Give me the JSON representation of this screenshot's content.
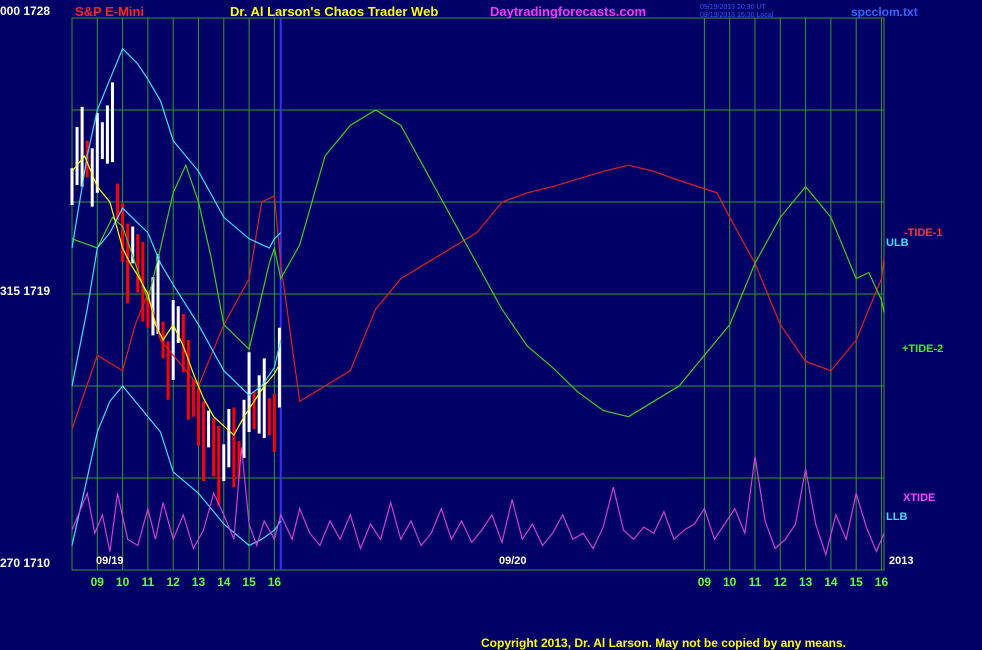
{
  "header": {
    "instrument": "S&P E-Mini",
    "title": "Dr. Al Larson's Chaos Trader Web",
    "website": "Daytradingforecasts.com",
    "timestamp_line1": "09/19/2013 20:30 UT",
    "timestamp_line2": "09/19/2013 15:30 Local",
    "file": "spcclom.txt"
  },
  "axis_labels": {
    "top": "000  1728",
    "mid": "315  1719",
    "bottom": "270  1710",
    "date_left": "09/19",
    "date_mid": "09/20",
    "year": "2013"
  },
  "series_labels": {
    "tide1": "-TIDE-1",
    "ulb": "ULB",
    "tide2": "+TIDE-2",
    "xtide": "XTIDE",
    "llb": "LLB"
  },
  "copyright": "Copyright 2013, Dr. Al Larson. May not be copied by any means.",
  "colors": {
    "background": "#000066",
    "grid": "#339933",
    "divider": "#3333ff",
    "bars_up": "#ffffff",
    "bars_down": "#ff0000",
    "tide1": "#dd2222",
    "tide2": "#44cc22",
    "bands": "#44ddff",
    "xtide": "#cc44cc",
    "ema": "#ffff00",
    "tick_labels": "#66ff33"
  },
  "chart_data": {
    "type": "line",
    "title": "Dr. Al Larson's Chaos Trader Web",
    "x_tick_labels": [
      "09",
      "10",
      "11",
      "12",
      "13",
      "14",
      "15",
      "16",
      "09",
      "10",
      "11",
      "12",
      "13",
      "14",
      "15",
      "16"
    ],
    "x_tick_hours": [
      9,
      10,
      11,
      12,
      13,
      14,
      15,
      16,
      33,
      34,
      35,
      36,
      37,
      38,
      39,
      40
    ],
    "xlim": [
      8,
      40.1
    ],
    "ylim": [
      1710,
      1728
    ],
    "y_tick_labels": [
      "000  1728",
      "315  1719",
      "270  1710"
    ],
    "grid": true,
    "divider_hour": 16.25,
    "series": [
      {
        "name": "-TIDE-1",
        "color": "#dd2222",
        "x": [
          8,
          9,
          10,
          10.5,
          11,
          11.5,
          12,
          13,
          14,
          15,
          15.5,
          16,
          16.25,
          17,
          19,
          20,
          21,
          22,
          23,
          24,
          25,
          26,
          27,
          29,
          30,
          31,
          32,
          33.5,
          34,
          35,
          36,
          37,
          38,
          39,
          39.5,
          40,
          40.1
        ],
        "y": [
          1714.6,
          1717,
          1716.5,
          1718,
          1719,
          1717.5,
          1717,
          1716,
          1718,
          1719.5,
          1722,
          1722.2,
          1720,
          1715.5,
          1716.5,
          1718.5,
          1719.5,
          1720,
          1720.5,
          1721,
          1722,
          1722.3,
          1722.5,
          1723,
          1723.2,
          1723,
          1722.7,
          1722.3,
          1721.5,
          1720,
          1718,
          1716.8,
          1716.5,
          1717.5,
          1718.5,
          1719.5,
          1720.2
        ]
      },
      {
        "name": "+TIDE-2",
        "color": "#44cc22",
        "x": [
          8,
          9,
          9.6,
          10,
          11,
          11.5,
          12,
          12.5,
          13,
          13.5,
          14,
          15,
          15.8,
          16,
          16.25,
          17,
          18,
          19,
          20,
          21,
          22,
          23,
          24,
          25,
          26,
          27,
          28,
          29,
          30,
          31,
          32,
          33,
          34,
          35,
          36,
          37,
          38,
          38.5,
          39,
          39.5,
          40,
          40.1
        ],
        "y": [
          1720.8,
          1720.5,
          1721.5,
          1721.2,
          1718.8,
          1720.5,
          1722.3,
          1723.2,
          1722,
          1720.2,
          1718,
          1717.2,
          1720,
          1720.5,
          1719.5,
          1720.6,
          1723.5,
          1724.5,
          1725,
          1724.5,
          1723,
          1721.5,
          1720,
          1718.5,
          1717.3,
          1716.6,
          1715.8,
          1715.2,
          1715,
          1715.5,
          1716,
          1717,
          1718,
          1720,
          1721.5,
          1722.5,
          1721.5,
          1720.5,
          1719.5,
          1719.7,
          1718.8,
          1718.4
        ]
      },
      {
        "name": "ULB",
        "color": "#44ddff",
        "x": [
          8,
          8.6,
          9,
          9.5,
          10,
          10.6,
          11,
          11.5,
          12,
          13,
          14,
          15,
          15.8,
          16,
          16.25
        ],
        "y": [
          1720.5,
          1723.5,
          1725,
          1726,
          1727,
          1726.5,
          1726,
          1725.3,
          1724,
          1723,
          1721.5,
          1720.8,
          1720.5,
          1720.8,
          1721
        ]
      },
      {
        "name": "Mid band",
        "color": "#44ddff",
        "x": [
          8,
          8.6,
          9,
          9.5,
          10,
          10.5,
          11,
          11.5,
          12,
          13,
          14,
          15,
          15.5,
          16,
          16.25
        ],
        "y": [
          1716,
          1718.5,
          1720.5,
          1721,
          1721.8,
          1721.4,
          1721,
          1720,
          1719.3,
          1718,
          1716.5,
          1715.7,
          1716,
          1716.6,
          1717.5
        ]
      },
      {
        "name": "LLB",
        "color": "#44ddff",
        "x": [
          8,
          8.6,
          9,
          9.5,
          10,
          10.5,
          11,
          11.5,
          12,
          13,
          14,
          15,
          15.5,
          16,
          16.25
        ],
        "y": [
          1710.8,
          1713,
          1714.5,
          1715.5,
          1716,
          1715.5,
          1715,
          1714.5,
          1713.2,
          1712.5,
          1711.5,
          1710.8,
          1711,
          1711.3,
          1711.6
        ]
      },
      {
        "name": "XTIDE",
        "color": "#cc44cc",
        "x": [
          8,
          8.6,
          8.9,
          9.2,
          9.5,
          9.8,
          10.2,
          10.6,
          11,
          11.3,
          11.6,
          12,
          12.4,
          12.8,
          13.2,
          13.6,
          14,
          14.4,
          14.7,
          15,
          15.3,
          15.6,
          16,
          16.25,
          16.7,
          17,
          17.4,
          17.8,
          18.2,
          18.6,
          19,
          19.4,
          19.8,
          20.2,
          20.6,
          21,
          21.4,
          21.8,
          22.2,
          22.6,
          23,
          23.4,
          23.8,
          24.2,
          24.6,
          25,
          25.4,
          25.8,
          26.2,
          26.6,
          27,
          27.4,
          27.8,
          28.2,
          28.6,
          29,
          29.4,
          29.8,
          30.2,
          30.6,
          31,
          31.4,
          31.8,
          32.2,
          32.6,
          33,
          33.4,
          33.8,
          34.2,
          34.6,
          35,
          35.4,
          35.8,
          36.2,
          36.6,
          37,
          37.4,
          37.8,
          38.2,
          38.6,
          39,
          39.4,
          39.8,
          40.1
        ],
        "y": [
          1711.3,
          1712.5,
          1711.2,
          1711.8,
          1710.6,
          1712.5,
          1711,
          1710.8,
          1712,
          1711,
          1712.2,
          1711,
          1711.8,
          1710.7,
          1711.3,
          1712.5,
          1711.8,
          1711,
          1714,
          1711.5,
          1710.8,
          1711.6,
          1711,
          1711.8,
          1711,
          1712,
          1711.2,
          1710.8,
          1711.6,
          1711,
          1711.8,
          1710.7,
          1711.5,
          1711,
          1712.2,
          1711,
          1711.6,
          1710.8,
          1711.2,
          1712,
          1711,
          1711.6,
          1710.9,
          1711.3,
          1711.8,
          1710.9,
          1712.3,
          1711,
          1711.5,
          1710.8,
          1711.2,
          1711.8,
          1711,
          1711.2,
          1710.7,
          1711.4,
          1712.7,
          1711.3,
          1711,
          1711.4,
          1711.2,
          1711.9,
          1711,
          1711.3,
          1711.5,
          1712,
          1711,
          1711.5,
          1712,
          1711.2,
          1713.7,
          1711.6,
          1710.7,
          1711,
          1711.5,
          1713.3,
          1711.5,
          1710.5,
          1711.8,
          1711,
          1712.5,
          1711.4,
          1710.6,
          1711.2
        ]
      },
      {
        "name": "EMA",
        "color": "#ffff00",
        "x": [
          8,
          8.5,
          9,
          9.5,
          10,
          10.3,
          10.6,
          11,
          11.3,
          11.6,
          12,
          12.4,
          12.8,
          13.2,
          13.6,
          14,
          14.4,
          14.8,
          15.2,
          15.6,
          16,
          16.2
        ],
        "y": [
          1723,
          1723.5,
          1722.5,
          1722,
          1720.5,
          1720,
          1719.6,
          1719,
          1718,
          1717.5,
          1718,
          1717.3,
          1716.4,
          1715.6,
          1715,
          1714.7,
          1714.4,
          1715,
          1715.5,
          1716,
          1716.4,
          1716.7
        ]
      }
    ],
    "ohlc_approx": {
      "note_hours": [
        8,
        8.2,
        8.4,
        8.6,
        8.8,
        9,
        9.2,
        9.4,
        9.6,
        9.8,
        10,
        10.2,
        10.4,
        10.6,
        10.8,
        11,
        11.2,
        11.4,
        11.6,
        11.8,
        12,
        12.2,
        12.4,
        12.6,
        12.8,
        13,
        13.2,
        13.4,
        13.6,
        13.8,
        14,
        14.2,
        14.4,
        14.6,
        14.8,
        15,
        15.2,
        15.4,
        15.6,
        15.8,
        16,
        16.2
      ],
      "close": [
        1722.5,
        1723.5,
        1723.8,
        1723.4,
        1722.8,
        1723.6,
        1724,
        1724.2,
        1724.6,
        1722,
        1721,
        1720,
        1720.6,
        1720,
        1719.4,
        1718.5,
        1718.6,
        1719,
        1717.5,
        1716.5,
        1717.5,
        1718,
        1717.4,
        1716.2,
        1715.6,
        1715,
        1714.2,
        1714.6,
        1714,
        1713.4,
        1713.5,
        1714.3,
        1714,
        1713.6,
        1714.6,
        1715.8,
        1715.2,
        1715.4,
        1715.6,
        1715,
        1714.8,
        1716.6
      ],
      "up": [
        true,
        true,
        true,
        false,
        true,
        true,
        true,
        true,
        true,
        false,
        false,
        false,
        true,
        false,
        false,
        false,
        true,
        true,
        false,
        false,
        true,
        true,
        false,
        false,
        false,
        false,
        false,
        true,
        false,
        false,
        true,
        true,
        false,
        false,
        true,
        true,
        false,
        true,
        true,
        false,
        false,
        true
      ]
    }
  }
}
